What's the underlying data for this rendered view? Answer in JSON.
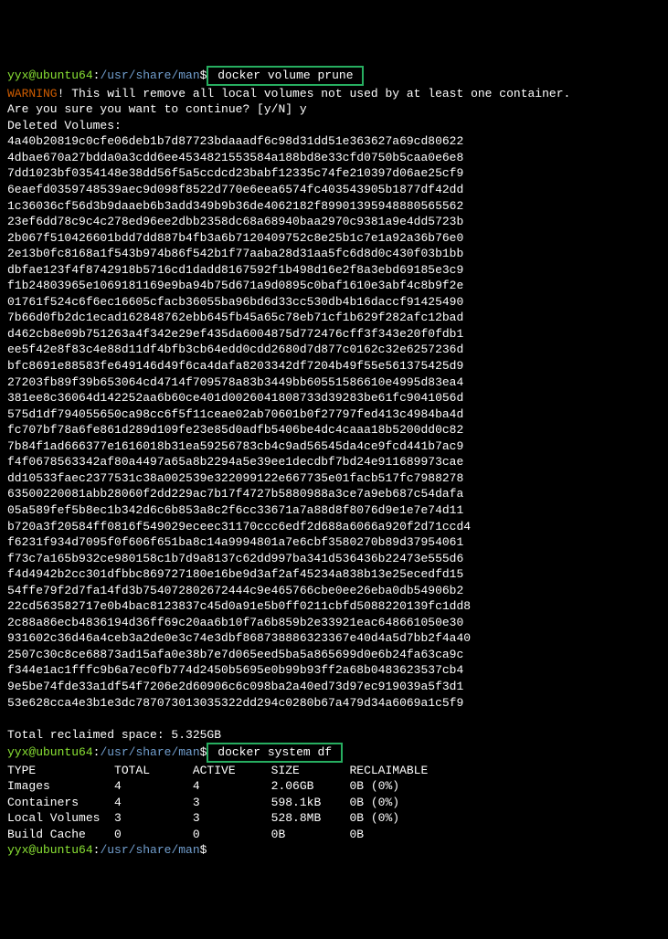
{
  "prompt": {
    "user_host": "yyx@ubuntu64",
    "colon": ":",
    "path": "/usr/share/man",
    "dollar": "$"
  },
  "commands": {
    "cmd1": " docker volume prune ",
    "cmd2": " docker system df ",
    "cmd1_indent": "7"
  },
  "warning": {
    "label": "WARNING",
    "text": "! This will remove all local volumes not used by at least one container."
  },
  "confirm": "Are you sure you want to continue? [y/N] y",
  "deleted_label": "Deleted Volumes:",
  "hashes": [
    "4a40b20819c0cfe06deb1b7d87723bdaaadf6c98d31dd51e363627a69cd80622",
    "4dbae670a27bdda0a3cdd6ee4534821553584a188bd8e33cfd0750b5caa0e6e8",
    "7dd1023bf0354148e38dd56f5a5ccdcd23babf12335c74fe210397d06ae25cf9",
    "6eaefd0359748539aec9d098f8522d770e6eea6574fc403543905b1877df42dd",
    "1c36036cf56d3b9daaeb6b3add349b9b36de4062182f89901395948880565562",
    "23ef6dd78c9c4c278ed96ee2dbb2358dc68a68940baa2970c9381a9e4dd5723b",
    "2b067f510426601bdd7dd887b4fb3a6b7120409752c8e25b1c7e1a92a36b76e0",
    "2e13b0fc8168a1f543b974b86f542b1f77aaba28d31aa5fc6d8d0c430f03b1bb",
    "dbfae123f4f8742918b5716cd1dadd8167592f1b498d16e2f8a3ebd69185e3c9",
    "f1b24803965e1069181169e9ba94b75d671a9d0895c0baf1610e3abf4c8b9f2e",
    "01761f524c6f6ec16605cfacb36055ba96bd6d33cc530db4b16daccf91425490",
    "7b66d0fb2dc1ecad162848762ebb645fb45a65c78eb71cf1b629f282afc12bad",
    "d462cb8e09b751263a4f342e29ef435da6004875d772476cff3f343e20f0fdb1",
    "ee5f42e8f83c4e88d11df4bfb3cb64edd0cdd2680d7d877c0162c32e6257236d",
    "bfc8691e88583fe649146d49f6ca4dafa8203342df7204b49f55e561375425d9",
    "27203fb89f39b653064cd4714f709578a83b3449bb60551586610e4995d83ea4",
    "381ee8c36064d142252aa6b60ce401d0026041808733d39283be61fc9041056d",
    "575d1df794055650ca98cc6f5f11ceae02ab70601b0f27797fed413c4984ba4d",
    "fc707bf78a6fe861d289d109fe23e85d0adfb5406be4dc4caaa18b5200dd0c82",
    "7b84f1ad666377e1616018b31ea59256783cb4c9ad56545da4ce9fcd441b7ac9",
    "f4f0678563342af80a4497a65a8b2294a5e39ee1decdbf7bd24e911689973cae",
    "dd10533faec2377531c38a002539e322099122e667735e01facb517fc7988278",
    "63500220081abb28060f2dd229ac7b17f4727b5880988a3ce7a9eb687c54dafa",
    "05a589fef5b8ec1b342d6c6b853a8c2f6cc33671a7a88d8f8076d9e1e7e74d11",
    "b720a3f20584ff0816f549029eceec31170ccc6edf2d688a6066a920f2d71ccd4",
    "f6231f934d7095f0f606f651ba8c14a9994801a7e6cbf3580270b89d37954061",
    "f73c7a165b932ce980158c1b7d9a8137c62dd997ba341d536436b22473e555d6",
    "f4d4942b2cc301dfbbc869727180e16be9d3af2af45234a838b13e25ecedfd15",
    "54ffe79f2d7fa14fd3b754072802672444c9e465766cbe0ee26eba0db54906b2",
    "22cd563582717e0b4bac8123837c45d0a91e5b0ff0211cbfd5088220139fc1dd8",
    "2c88a86ecb4836194d36ff69c20aa6b10f7a6b859b2e33921eac648661050e30",
    "931602c36d46a4ceb3a2de0e3c74e3dbf868738886323367e40d4a5d7bb2f4a40",
    "2507c30c8ce68873ad15afa0e38b7e7d065eed5ba5a865699d0e6b24fa63ca9c",
    "f344e1ac1fffc9b6a7ec0fb774d2450b5695e0b99b93ff2a68b0483623537cb4",
    "9e5be74fde33a1df54f7206e2d60906c6c098ba2a40ed73d97ec919039a5f3d1",
    "53e628cca4e3b1e3dc787073013035322dd294c0280b67a479d34a6069a1c5f9"
  ],
  "blank": " ",
  "reclaimed": "Total reclaimed space: 5.325GB",
  "table": {
    "header": "TYPE           TOTAL      ACTIVE     SIZE       RECLAIMABLE",
    "rows": [
      "Images         4          4          2.06GB     0B (0%)",
      "Containers     4          3          598.1kB    0B (0%)",
      "Local Volumes  3          3          528.8MB    0B (0%)",
      "Build Cache    0          0          0B         0B"
    ]
  }
}
